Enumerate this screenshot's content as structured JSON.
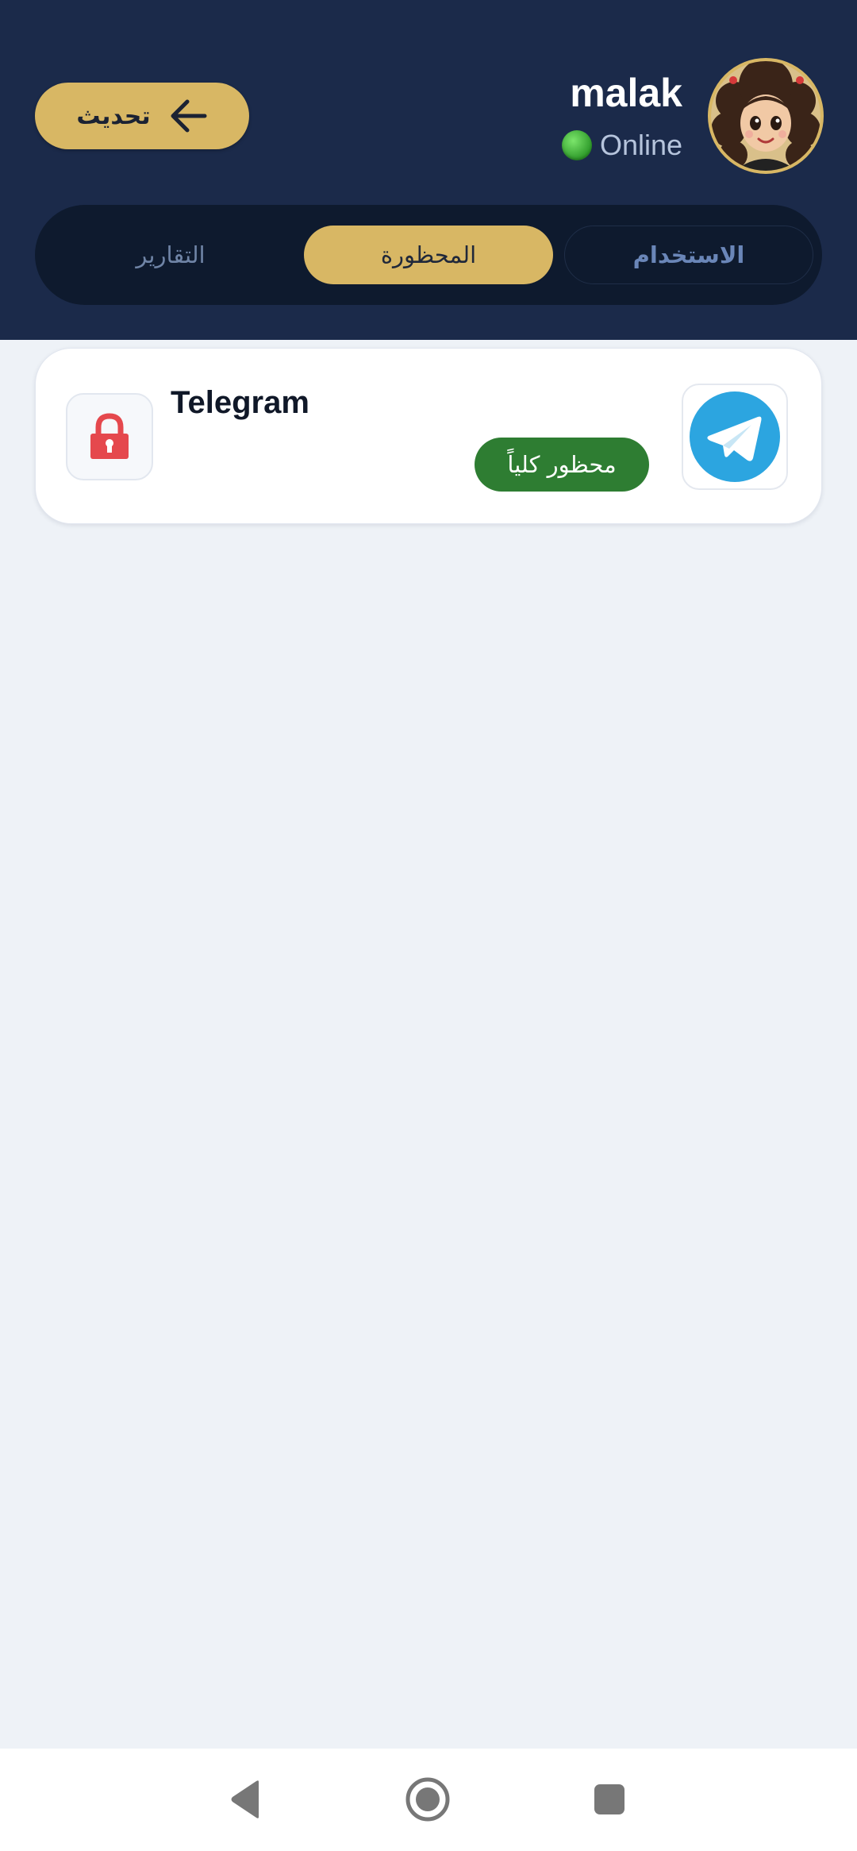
{
  "header": {
    "refresh_label": "تحديث",
    "user_name": "malak",
    "status_text": "Online"
  },
  "tabs": [
    {
      "id": "usage",
      "label": "الاستخدام",
      "active": false
    },
    {
      "id": "blocked",
      "label": "المحظورة",
      "active": true
    },
    {
      "id": "reports",
      "label": "التقارير",
      "active": false
    }
  ],
  "blocked_apps": [
    {
      "name": "Telegram",
      "status_label": "محظور كلياً",
      "icon": "telegram-icon"
    }
  ],
  "colors": {
    "header_bg": "#1b2a4a",
    "accent_gold": "#d8b764",
    "badge_green": "#2e7d32",
    "lock_red": "#e5484d",
    "telegram_blue": "#2ca5e0"
  },
  "icons": {
    "refresh": "arrow-left-icon",
    "status": "green-dot-icon",
    "lock": "lock-icon",
    "nav": [
      "back-triangle-icon",
      "home-circle-icon",
      "recents-square-icon"
    ]
  }
}
